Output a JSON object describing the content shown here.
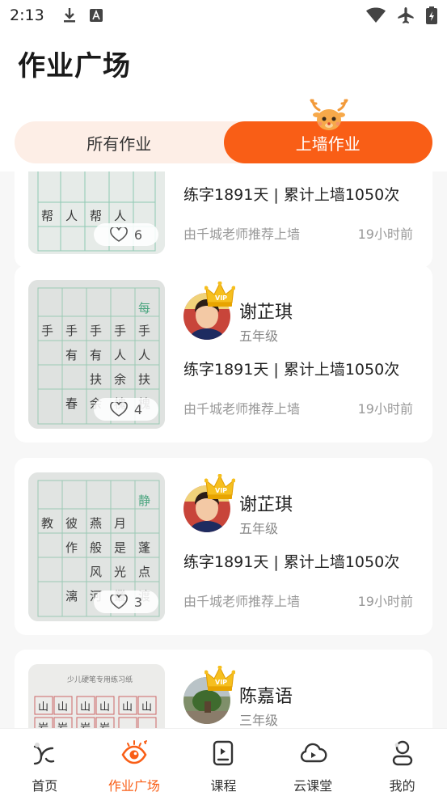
{
  "status_bar": {
    "time": "2:13",
    "left_icons": [
      "download-icon",
      "font-icon"
    ],
    "right_icons": [
      "wifi-icon",
      "airplane-icon",
      "battery-icon"
    ]
  },
  "page": {
    "title": "作业广场"
  },
  "tabs": [
    {
      "label": "所有作业",
      "active": false
    },
    {
      "label": "上墙作业",
      "active": true
    }
  ],
  "accent_color": "#f95e16",
  "cards": [
    {
      "name": "",
      "grade": "",
      "stats": "练字1891天 | 累计上墙1050次",
      "recommend": "由千城老师推荐上墙",
      "time": "19小时前",
      "likes": "6"
    },
    {
      "name": "谢芷琪",
      "grade": "五年级",
      "stats": "练字1891天 | 累计上墙1050次",
      "recommend": "由千城老师推荐上墙",
      "time": "19小时前",
      "likes": "4"
    },
    {
      "name": "谢芷琪",
      "grade": "五年级",
      "stats": "练字1891天 | 累计上墙1050次",
      "recommend": "由千城老师推荐上墙",
      "time": "19小时前",
      "likes": "3"
    },
    {
      "name": "陈嘉语",
      "grade": "三年级",
      "stats": "",
      "recommend": "",
      "time": "",
      "likes": ""
    }
  ],
  "bottom_nav": [
    {
      "label": "首页",
      "icon": "home-icon",
      "active": false
    },
    {
      "label": "作业广场",
      "icon": "square-eye-icon",
      "active": true
    },
    {
      "label": "课程",
      "icon": "course-icon",
      "active": false
    },
    {
      "label": "云课堂",
      "icon": "cloud-play-icon",
      "active": false
    },
    {
      "label": "我的",
      "icon": "profile-icon",
      "active": false
    }
  ]
}
